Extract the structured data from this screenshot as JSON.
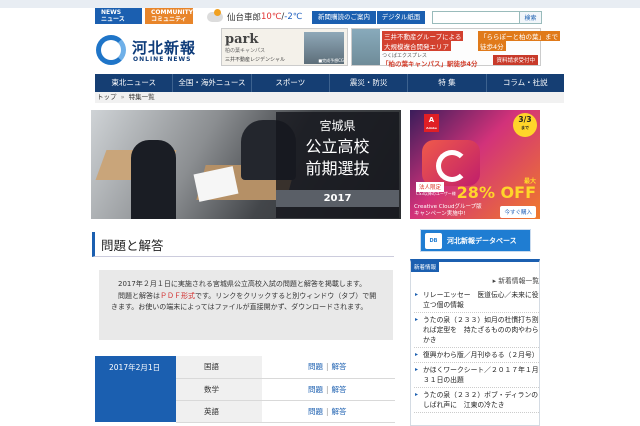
{
  "top_tabs": [
    {
      "en": "NEWS",
      "ja": "ニュース"
    },
    {
      "en": "COMMUNITY",
      "ja": "コミュニティ"
    }
  ],
  "weather": {
    "city": "仙台車郎",
    "high": "10℃",
    "sep": "/",
    "low": "-2℃"
  },
  "header_buttons": {
    "subscribe": "新聞購読のご案内",
    "digital": "デジタル紙面"
  },
  "search": {
    "placeholder": "",
    "button": "検索"
  },
  "logo": {
    "name": "河北新報",
    "sub": "ONLINE NEWS"
  },
  "ads": {
    "park": {
      "title": "park",
      "sub": "柏の葉キャンパス",
      "developer": "三井不動産レジデンシャル",
      "caption": "■完成予想CG"
    },
    "mitsui": {
      "line1": "三井不動産グループによる",
      "line2": "大規模複合開発エリア",
      "line3": "「ららぽーと柏の葉」まで",
      "line4": "徒歩4分",
      "line5": "つくばエクスプレス",
      "line6": "「柏の葉キャンパス」駅徒歩4分",
      "cta": "資料請求受付中"
    },
    "adobe": {
      "logo": "A",
      "logo_sub": "Adobe",
      "badge_date": "3/3",
      "badge_sub": "まで",
      "tag": "法人限定",
      "tag_sub": "CS3以降のユーザー様",
      "off_label": "最大",
      "pct": "28% OFF",
      "footer_line1": "Creative Cloudグループ版",
      "footer_line2": "キャンペーン実施中!",
      "button": "今すぐ購入"
    }
  },
  "nav": [
    "東北ニュース",
    "全国・海外ニュース",
    "スポーツ",
    "震災・防災",
    "特 集",
    "コラム・社説"
  ],
  "breadcrumb": {
    "home": "トップ",
    "sep": "»",
    "current": "特集一覧"
  },
  "hero": {
    "line1": "宮城県",
    "line2": "公立高校",
    "line3": "前期選抜",
    "year": "2017"
  },
  "page_title": "問題と解答",
  "intro": {
    "p1": "2017年２月１日に実施される宮城県公立高校入試の問題と解答を掲載します。",
    "p2_prefix": "問題と解答は",
    "p2_pdf": "ＰＤＦ形式",
    "p2_suffix": "です。リンクをクリックすると別ウィンドウ（タブ）で開きます。お使いの端末によってはファイルが直接開かず、ダウンロードされます。"
  },
  "results": {
    "date": "2017年2月1日",
    "rows": [
      {
        "subject": "国語",
        "q": "問題",
        "a": "解答"
      },
      {
        "subject": "数学",
        "q": "問題",
        "a": "解答"
      },
      {
        "subject": "英語",
        "q": "問題",
        "a": "解答"
      }
    ]
  },
  "db_banner": {
    "mark": "DB",
    "label": "河北新報データベース"
  },
  "news": {
    "label": "新着情報",
    "more": "▸ 新着情報一覧",
    "items": [
      "リレーエッセー　医道伝心／未来に役立つ個の情報",
      "うたの泉（２３３）如月の杜慣打ち割れば定型を　持たざるものの肉やわらかき",
      "復興かわら版／月刊ゆるる（２月号）",
      "かほくワークシート／２０１７年１月３１日の出題",
      "うたの泉（２３２）ボブ・ディランのしばれ声に　江東の冷たき"
    ]
  }
}
